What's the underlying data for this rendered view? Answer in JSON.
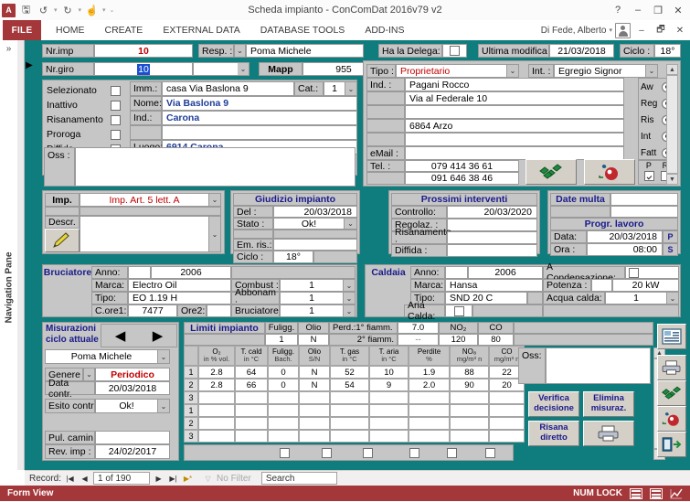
{
  "window": {
    "title": "Scheda impianto - ConComDat 2016v79 v2",
    "qat": [
      "access-icon",
      "save-icon",
      "undo-icon",
      "redo-icon",
      "touch-icon",
      "customize-icon"
    ],
    "buttons": {
      "help": "?",
      "minimize": "–",
      "restore": "❐",
      "close": "✕"
    }
  },
  "ribbon": {
    "file_tab": "FILE",
    "tabs": [
      "HOME",
      "CREATE",
      "EXTERNAL DATA",
      "DATABASE TOOLS",
      "ADD-INS"
    ],
    "user": "Di Fede, Alberto",
    "buttons": {
      "minimize": "–",
      "restore": "🗗",
      "close": "✕"
    }
  },
  "navpane": {
    "label": "Navigation Pane",
    "chevron": "»"
  },
  "header": {
    "nr_imp_label": "Nr.imp",
    "nr_imp_value": "10",
    "resp_label": "Resp. :",
    "resp_value": "Poma Michele",
    "delega_label": "Ha la Delega:",
    "delega_checked": false,
    "ultima_modifica_label": "Ultima modifica",
    "ultima_modifica_value": "21/03/2018",
    "ciclo_label": "Ciclo :",
    "ciclo_value": "18°",
    "nr_giro_label": "Nr.giro",
    "nr_giro_value": "10",
    "mapp_label": "Mapp",
    "mapp_value": "955"
  },
  "impianto": {
    "checks": [
      {
        "label": "Selezionato",
        "checked": false
      },
      {
        "label": "Inattivo",
        "checked": false
      },
      {
        "label": "Risanamento",
        "checked": false
      },
      {
        "label": "Proroga",
        "checked": false
      },
      {
        "label": "Diffida",
        "checked": false
      }
    ],
    "imm_label": "Imm.:",
    "imm_value": "casa Via Baslona 9",
    "cat_label": "Cat.:",
    "cat_value": "1",
    "nome_label": "Nome:",
    "nome_value": "Via Baslona 9",
    "ind_label": "Ind.:",
    "ind_value": "Carona",
    "ind_value2": "",
    "luogo_label": "Luogo:",
    "luogo_value": "6914 Carona",
    "oss_label": "Oss :",
    "oss_value": ""
  },
  "proprietario": {
    "tipo_label": "Tipo :",
    "tipo_value": "Proprietario",
    "int_label": "Int. :",
    "int_value": "Egregio Signor",
    "ind_label": "Ind. :",
    "address_lines": [
      "Pagani Rocco",
      "Via al Federale 10",
      "",
      "6864 Arzo",
      ""
    ],
    "email_label": "eMail :",
    "email_value": "",
    "tel_label": "Tel. :",
    "tel_value1": "079 414 36 61",
    "tel_value2": "091 646 38 46",
    "radios": [
      "Aw",
      "Reg",
      "Ris",
      "Int",
      "Fatt"
    ],
    "pr_labels": [
      "P",
      "R"
    ],
    "p_checked": true,
    "r_checked": false,
    "money_icon": "money-icon",
    "bomb_icon": "bomb-icon"
  },
  "imp_block": {
    "imp_label": "Imp.",
    "imp_value": "Imp. Art. 5 lett. A",
    "descr_label": "Descr.",
    "descr_value": "",
    "pencil_icon": "pencil-icon"
  },
  "giudizio": {
    "title": "Giudizio impianto",
    "rows": [
      {
        "label": "Del :",
        "value": "20/03/2018"
      },
      {
        "label": "Stato :",
        "value": "Ok!"
      },
      {
        "label": "Em. ris.:",
        "value": ""
      },
      {
        "label": "Ciclo :",
        "value": "18°"
      }
    ]
  },
  "prossimi": {
    "title": "Prossimi interventi",
    "rows": [
      {
        "label": "Controllo:",
        "value": "20/03/2020"
      },
      {
        "label": "Regolaz. :",
        "value": ""
      },
      {
        "label": "Risanamento :",
        "value": ""
      },
      {
        "label": "Diffida   :",
        "value": ""
      }
    ]
  },
  "date_multa": {
    "title": "Date multa",
    "value1": "",
    "value2": ""
  },
  "progr_lavoro": {
    "title": "Progr. lavoro",
    "data_label": "Data:",
    "data_value": "20/03/2018",
    "data_btn": "P",
    "ora_label": "Ora :",
    "ora_value": "08:00",
    "ora_btn": "S"
  },
  "bruciatore": {
    "title": "Bruciatore",
    "anno_label": "Anno:",
    "anno_value": "2006",
    "marca_label": "Marca:",
    "marca_value": "Electro Oil",
    "tipo_label": "Tipo:",
    "tipo_value": "EO 1.19 H",
    "core1_label": "C.ore1:",
    "core1_value": "7477",
    "ore2_label": "Ore2:",
    "ore2_value": "",
    "combust_label": "Combust :",
    "combust_value": "1",
    "abbonam_label": "Abbonam :",
    "abbonam_value": "1",
    "bruciatore_label": "Bruciatore",
    "bruciatore_value": "1"
  },
  "caldaia": {
    "title": "Caldaia",
    "anno_label": "Anno:",
    "anno_value": "2006",
    "marca_label": "Marca:",
    "marca_value": "Hansa",
    "tipo_label": "Tipo:",
    "tipo_value": "SND 20 C",
    "aria_calda_label": "Aria Calda:",
    "aria_calda_checked": false,
    "cond_label": "A Condensazione:",
    "cond_checked": false,
    "potenza_label": "Potenza :",
    "potenza_value": "20 kW",
    "acqua_label": "Acqua calda:",
    "acqua_value": "1"
  },
  "misurazioni": {
    "title1": "Misurazioni",
    "title2": "ciclo attuale",
    "prev_icon": "arrow-left-icon",
    "next_icon": "arrow-right-icon",
    "operatore_value": "Poma Michele",
    "genere_label": "Genere",
    "genere_value": "Periodico",
    "data_contr_label": "Data contr.",
    "data_contr_value": "20/03/2018",
    "esito_label": "Esito contr",
    "esito_value": "Ok!",
    "pul_camin_label": "Pul. camin",
    "pul_camin_value": "",
    "rev_imp_label": "Rev. imp :",
    "rev_imp_value": "24/02/2017"
  },
  "limiti": {
    "title": "Limiti impianto",
    "cols": [
      "Fuligg.",
      "Olio",
      "",
      ""
    ],
    "fuligg_label": "Fuligg.",
    "olio_label": "Olio",
    "perd1_label": "Perd.:1° fiamm.",
    "perd2_label": "2° fiamm.",
    "no2_label": "NO₂",
    "co_label": "CO",
    "row1": {
      "fuligg": "1",
      "olio": "N",
      "perd": "7.0",
      "no2": "NO₂",
      "co": "CO"
    },
    "row1_vals": [
      "1",
      "N",
      "7.0"
    ],
    "row2_vals": [
      "--",
      "120",
      "80"
    ],
    "perd_val1": "7.0",
    "no2_val_head": "NO₂",
    "co_val_head": "CO",
    "perd_val2": "--",
    "no2_val2": "120",
    "co_val2": "80"
  },
  "meas_table": {
    "headers": [
      {
        "l1": "O₂",
        "l2": "in % vol."
      },
      {
        "l1": "T. cald",
        "l2": "in °C"
      },
      {
        "l1": "Fuligg.",
        "l2": "Bach."
      },
      {
        "l1": "Olio",
        "l2": "S/N"
      },
      {
        "l1": "T. gas",
        "l2": "in °C"
      },
      {
        "l1": "T. aria",
        "l2": "in °C"
      },
      {
        "l1": "Perdite",
        "l2": "%"
      },
      {
        "l1": "NO₈",
        "l2": "mg/m³ n"
      },
      {
        "l1": "CO",
        "l2": "mg/m³ n"
      }
    ],
    "rows": [
      {
        "no": "1",
        "cells": [
          "2.8",
          "64",
          "0",
          "N",
          "52",
          "10",
          "1.9",
          "88",
          "22"
        ]
      },
      {
        "no": "2",
        "cells": [
          "2.8",
          "66",
          "0",
          "N",
          "54",
          "9",
          "2.0",
          "90",
          "20"
        ]
      },
      {
        "no": "3",
        "cells": [
          "",
          "",
          "",
          "",
          "",
          "",
          "",
          "",
          ""
        ]
      },
      {
        "no": "1",
        "cells": [
          "",
          "",
          "",
          "",
          "",
          "",
          "",
          "",
          ""
        ]
      },
      {
        "no": "2",
        "cells": [
          "",
          "",
          "",
          "",
          "",
          "",
          "",
          "",
          ""
        ]
      },
      {
        "no": "3",
        "cells": [
          "",
          "",
          "",
          "",
          "",
          "",
          "",
          "",
          ""
        ]
      }
    ],
    "footer_checks": [
      false,
      false,
      false,
      false,
      false,
      false
    ]
  },
  "oss_panel": {
    "label": "Oss:",
    "value": "",
    "buttons": [
      {
        "l1": "Verifica",
        "l2": "decisione",
        "name": "verifica-decisione-button"
      },
      {
        "l1": "Elimina",
        "l2": "misuraz.",
        "name": "elimina-misuraz-button"
      },
      {
        "l1": "Risana",
        "l2": "diretto",
        "name": "risana-diretto-button"
      }
    ],
    "print_icon": "printer-icon"
  },
  "toolbar_right": {
    "items": [
      {
        "icon": "report-icon",
        "name": "report-button"
      },
      {
        "icon": "printer-icon",
        "name": "print-button"
      },
      {
        "icon": "money-icon",
        "name": "money-button"
      },
      {
        "icon": "bomb-icon",
        "name": "bomb-button"
      },
      {
        "icon": "exit-icon",
        "name": "exit-button"
      }
    ]
  },
  "recordbar": {
    "label": "Record:",
    "first": "|◀",
    "prev": "◀",
    "value": "1 of 190",
    "next": "▶",
    "last": "▶|",
    "new": "▶*",
    "filter_icon": "filter-icon",
    "filter_text": "No Filter",
    "search_placeholder": "Search"
  },
  "statusbar": {
    "view": "Form View",
    "numlock": "NUM LOCK",
    "icons": [
      "form-view-icon",
      "datasheet-view-icon",
      "design-view-icon"
    ]
  }
}
